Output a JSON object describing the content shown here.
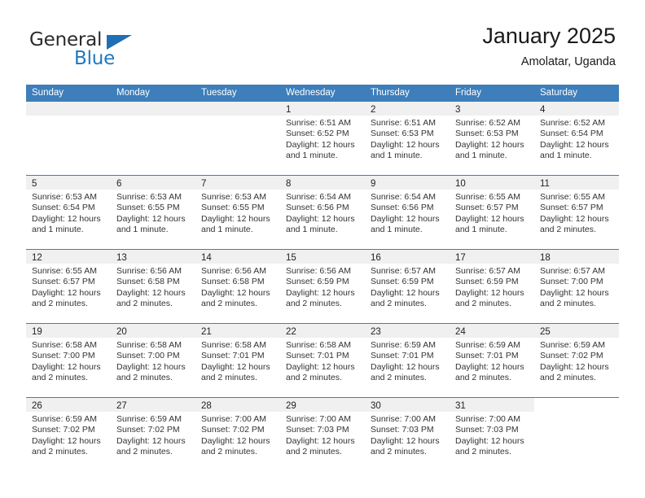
{
  "brand": {
    "name_top": "General",
    "name_bottom": "Blue",
    "color_blue": "#1f78c1",
    "color_dark": "#2b2b2b"
  },
  "header": {
    "title": "January 2025",
    "subtitle": "Amolatar, Uganda"
  },
  "theme": {
    "header_row_bg": "#3d7ebb",
    "day_band_bg": "#f0f0f0",
    "divider": "#3d7ebb"
  },
  "weekdays": [
    "Sunday",
    "Monday",
    "Tuesday",
    "Wednesday",
    "Thursday",
    "Friday",
    "Saturday"
  ],
  "labels": {
    "sunrise_prefix": "Sunrise:",
    "sunset_prefix": "Sunset:",
    "daylight_prefix": "Daylight:"
  },
  "weeks": [
    [
      {
        "day": "",
        "empty": true,
        "band": true
      },
      {
        "day": "",
        "empty": true,
        "band": true
      },
      {
        "day": "",
        "empty": true,
        "band": true
      },
      {
        "day": "1",
        "sunrise": "Sunrise: 6:51 AM",
        "sunset": "Sunset: 6:52 PM",
        "daylight1": "Daylight: 12 hours",
        "daylight2": "and 1 minute."
      },
      {
        "day": "2",
        "sunrise": "Sunrise: 6:51 AM",
        "sunset": "Sunset: 6:53 PM",
        "daylight1": "Daylight: 12 hours",
        "daylight2": "and 1 minute."
      },
      {
        "day": "3",
        "sunrise": "Sunrise: 6:52 AM",
        "sunset": "Sunset: 6:53 PM",
        "daylight1": "Daylight: 12 hours",
        "daylight2": "and 1 minute."
      },
      {
        "day": "4",
        "sunrise": "Sunrise: 6:52 AM",
        "sunset": "Sunset: 6:54 PM",
        "daylight1": "Daylight: 12 hours",
        "daylight2": "and 1 minute."
      }
    ],
    [
      {
        "day": "5",
        "sunrise": "Sunrise: 6:53 AM",
        "sunset": "Sunset: 6:54 PM",
        "daylight1": "Daylight: 12 hours",
        "daylight2": "and 1 minute."
      },
      {
        "day": "6",
        "sunrise": "Sunrise: 6:53 AM",
        "sunset": "Sunset: 6:55 PM",
        "daylight1": "Daylight: 12 hours",
        "daylight2": "and 1 minute."
      },
      {
        "day": "7",
        "sunrise": "Sunrise: 6:53 AM",
        "sunset": "Sunset: 6:55 PM",
        "daylight1": "Daylight: 12 hours",
        "daylight2": "and 1 minute."
      },
      {
        "day": "8",
        "sunrise": "Sunrise: 6:54 AM",
        "sunset": "Sunset: 6:56 PM",
        "daylight1": "Daylight: 12 hours",
        "daylight2": "and 1 minute."
      },
      {
        "day": "9",
        "sunrise": "Sunrise: 6:54 AM",
        "sunset": "Sunset: 6:56 PM",
        "daylight1": "Daylight: 12 hours",
        "daylight2": "and 1 minute."
      },
      {
        "day": "10",
        "sunrise": "Sunrise: 6:55 AM",
        "sunset": "Sunset: 6:57 PM",
        "daylight1": "Daylight: 12 hours",
        "daylight2": "and 1 minute."
      },
      {
        "day": "11",
        "sunrise": "Sunrise: 6:55 AM",
        "sunset": "Sunset: 6:57 PM",
        "daylight1": "Daylight: 12 hours",
        "daylight2": "and 2 minutes."
      }
    ],
    [
      {
        "day": "12",
        "sunrise": "Sunrise: 6:55 AM",
        "sunset": "Sunset: 6:57 PM",
        "daylight1": "Daylight: 12 hours",
        "daylight2": "and 2 minutes."
      },
      {
        "day": "13",
        "sunrise": "Sunrise: 6:56 AM",
        "sunset": "Sunset: 6:58 PM",
        "daylight1": "Daylight: 12 hours",
        "daylight2": "and 2 minutes."
      },
      {
        "day": "14",
        "sunrise": "Sunrise: 6:56 AM",
        "sunset": "Sunset: 6:58 PM",
        "daylight1": "Daylight: 12 hours",
        "daylight2": "and 2 minutes."
      },
      {
        "day": "15",
        "sunrise": "Sunrise: 6:56 AM",
        "sunset": "Sunset: 6:59 PM",
        "daylight1": "Daylight: 12 hours",
        "daylight2": "and 2 minutes."
      },
      {
        "day": "16",
        "sunrise": "Sunrise: 6:57 AM",
        "sunset": "Sunset: 6:59 PM",
        "daylight1": "Daylight: 12 hours",
        "daylight2": "and 2 minutes."
      },
      {
        "day": "17",
        "sunrise": "Sunrise: 6:57 AM",
        "sunset": "Sunset: 6:59 PM",
        "daylight1": "Daylight: 12 hours",
        "daylight2": "and 2 minutes."
      },
      {
        "day": "18",
        "sunrise": "Sunrise: 6:57 AM",
        "sunset": "Sunset: 7:00 PM",
        "daylight1": "Daylight: 12 hours",
        "daylight2": "and 2 minutes."
      }
    ],
    [
      {
        "day": "19",
        "sunrise": "Sunrise: 6:58 AM",
        "sunset": "Sunset: 7:00 PM",
        "daylight1": "Daylight: 12 hours",
        "daylight2": "and 2 minutes."
      },
      {
        "day": "20",
        "sunrise": "Sunrise: 6:58 AM",
        "sunset": "Sunset: 7:00 PM",
        "daylight1": "Daylight: 12 hours",
        "daylight2": "and 2 minutes."
      },
      {
        "day": "21",
        "sunrise": "Sunrise: 6:58 AM",
        "sunset": "Sunset: 7:01 PM",
        "daylight1": "Daylight: 12 hours",
        "daylight2": "and 2 minutes."
      },
      {
        "day": "22",
        "sunrise": "Sunrise: 6:58 AM",
        "sunset": "Sunset: 7:01 PM",
        "daylight1": "Daylight: 12 hours",
        "daylight2": "and 2 minutes."
      },
      {
        "day": "23",
        "sunrise": "Sunrise: 6:59 AM",
        "sunset": "Sunset: 7:01 PM",
        "daylight1": "Daylight: 12 hours",
        "daylight2": "and 2 minutes."
      },
      {
        "day": "24",
        "sunrise": "Sunrise: 6:59 AM",
        "sunset": "Sunset: 7:01 PM",
        "daylight1": "Daylight: 12 hours",
        "daylight2": "and 2 minutes."
      },
      {
        "day": "25",
        "sunrise": "Sunrise: 6:59 AM",
        "sunset": "Sunset: 7:02 PM",
        "daylight1": "Daylight: 12 hours",
        "daylight2": "and 2 minutes."
      }
    ],
    [
      {
        "day": "26",
        "sunrise": "Sunrise: 6:59 AM",
        "sunset": "Sunset: 7:02 PM",
        "daylight1": "Daylight: 12 hours",
        "daylight2": "and 2 minutes."
      },
      {
        "day": "27",
        "sunrise": "Sunrise: 6:59 AM",
        "sunset": "Sunset: 7:02 PM",
        "daylight1": "Daylight: 12 hours",
        "daylight2": "and 2 minutes."
      },
      {
        "day": "28",
        "sunrise": "Sunrise: 7:00 AM",
        "sunset": "Sunset: 7:02 PM",
        "daylight1": "Daylight: 12 hours",
        "daylight2": "and 2 minutes."
      },
      {
        "day": "29",
        "sunrise": "Sunrise: 7:00 AM",
        "sunset": "Sunset: 7:03 PM",
        "daylight1": "Daylight: 12 hours",
        "daylight2": "and 2 minutes."
      },
      {
        "day": "30",
        "sunrise": "Sunrise: 7:00 AM",
        "sunset": "Sunset: 7:03 PM",
        "daylight1": "Daylight: 12 hours",
        "daylight2": "and 2 minutes."
      },
      {
        "day": "31",
        "sunrise": "Sunrise: 7:00 AM",
        "sunset": "Sunset: 7:03 PM",
        "daylight1": "Daylight: 12 hours",
        "daylight2": "and 2 minutes."
      },
      {
        "day": "",
        "empty": true,
        "band": false
      }
    ]
  ]
}
